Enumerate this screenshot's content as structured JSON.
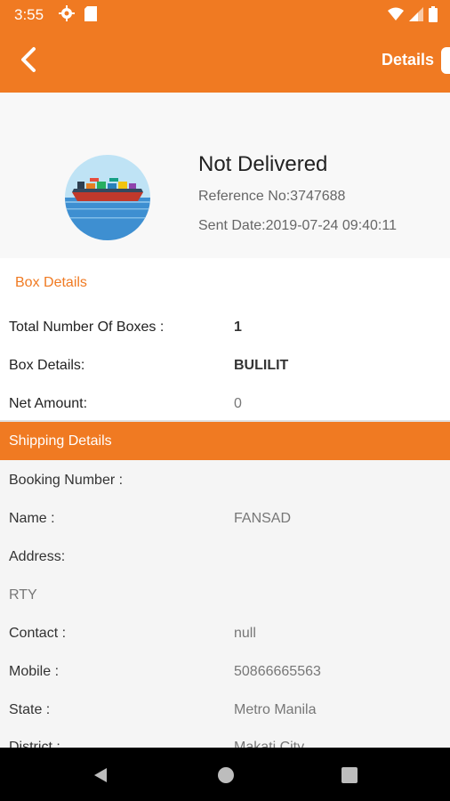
{
  "status_bar": {
    "time": "3:55"
  },
  "app_bar": {
    "title": "Details"
  },
  "shipment": {
    "status": "Not Delivered",
    "reference": "Reference No:3747688",
    "sent_date": "Sent Date:2019-07-24 09:40:11"
  },
  "box_details": {
    "header": "Box Details",
    "rows": [
      {
        "label": "Total Number Of Boxes :",
        "value": "1"
      },
      {
        "label": "Box Details:",
        "value": "BULILIT"
      },
      {
        "label": "Net Amount:",
        "value": "0"
      }
    ]
  },
  "shipping_details": {
    "header": "Shipping Details",
    "rows": [
      {
        "label": "Booking Number :",
        "value": ""
      },
      {
        "label": "Name :",
        "value": "FANSAD"
      },
      {
        "label": "Address:",
        "value": ""
      },
      {
        "label": "RTY",
        "value": ""
      },
      {
        "label": "Contact :",
        "value": "null"
      },
      {
        "label": "Mobile :",
        "value": "50866665563"
      },
      {
        "label": "State :",
        "value": "Metro Manila"
      },
      {
        "label": "District :",
        "value": "Makati City"
      }
    ]
  },
  "colors": {
    "accent": "#f07a22",
    "nav": "#000000"
  }
}
